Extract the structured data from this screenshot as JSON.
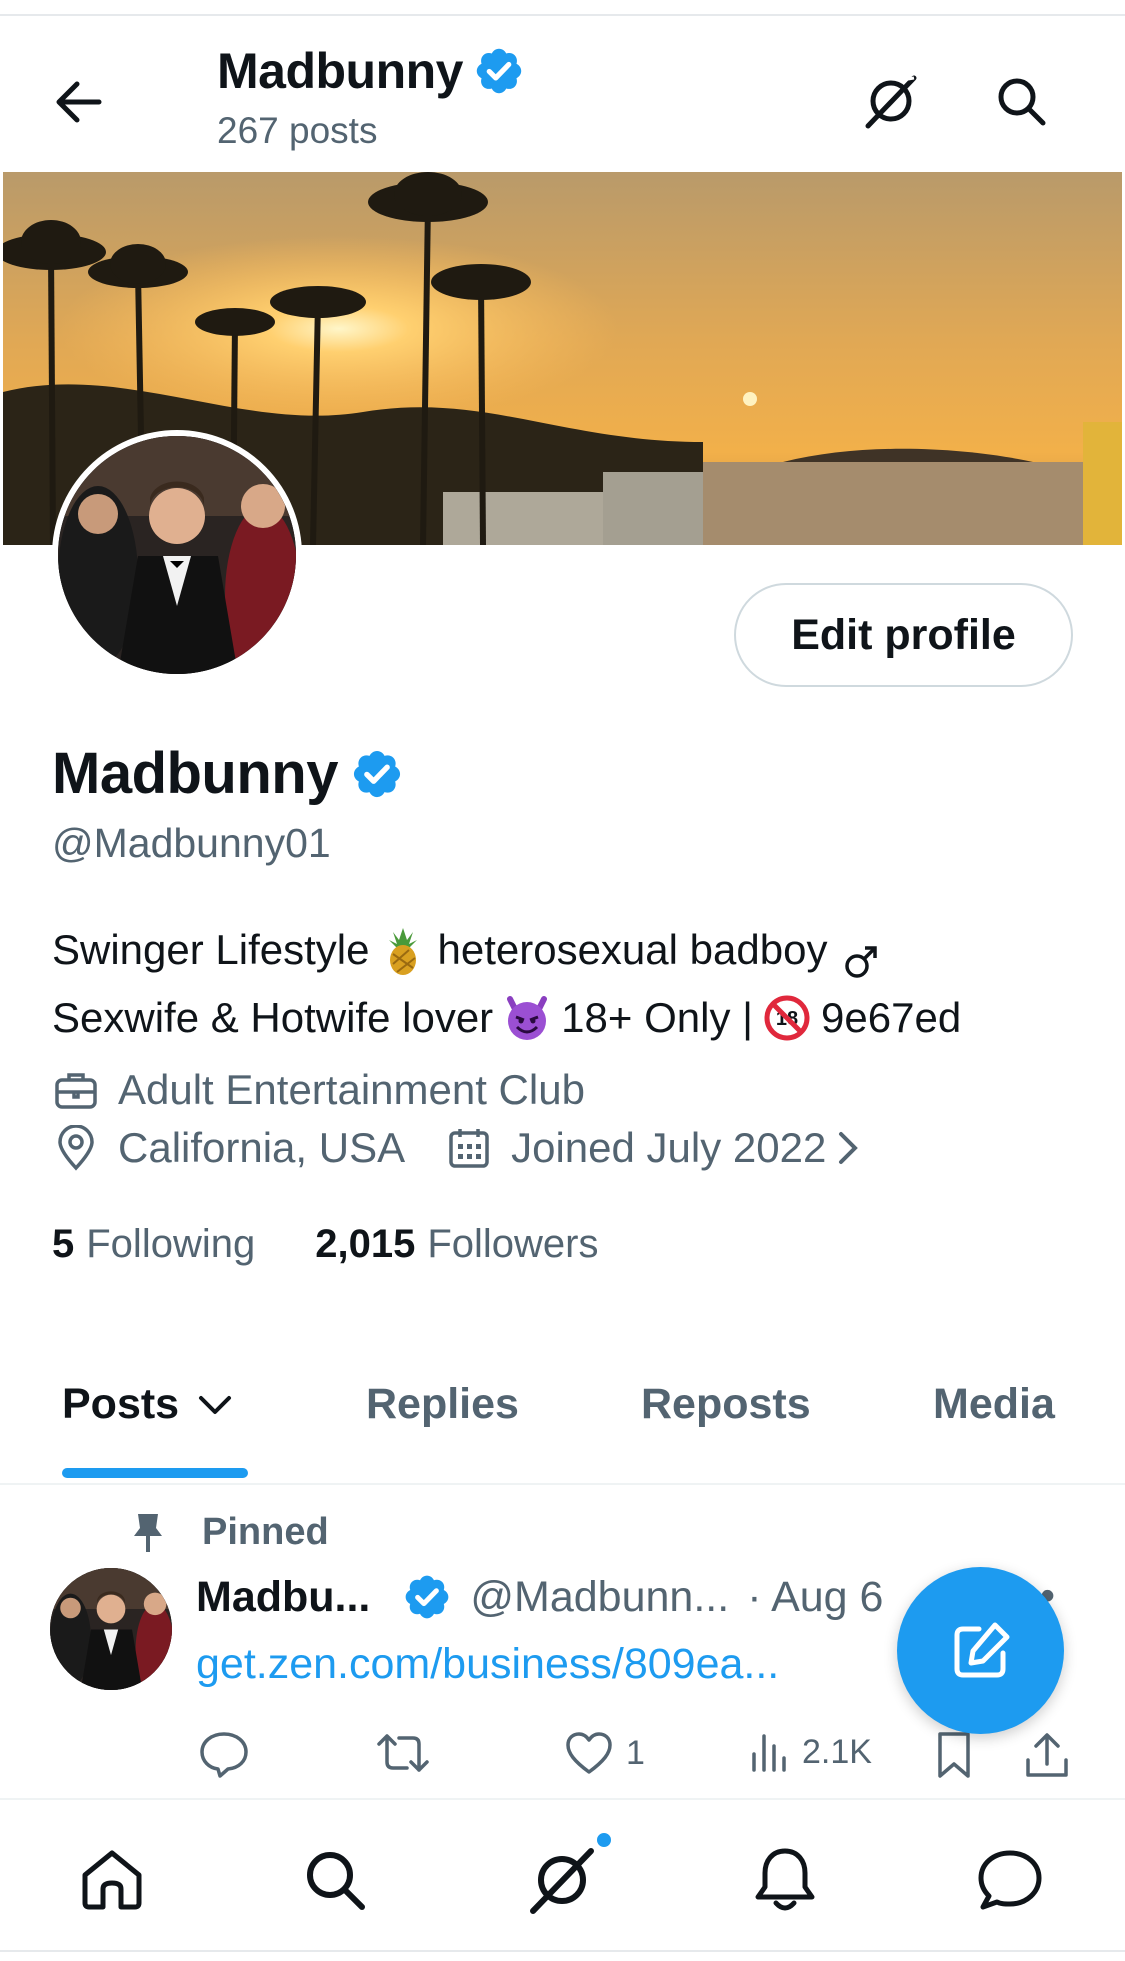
{
  "header": {
    "name": "Madbunny",
    "post_count": "267 posts"
  },
  "profile": {
    "display_name": "Madbunny",
    "handle": "@Madbunny01",
    "edit_button": "Edit profile",
    "bio": {
      "line1_a": "Swinger Lifestyle",
      "line1_b": "heterosexual badboy",
      "line2_a": "Sexwife & Hotwife lover",
      "line2_b": "18+ Only |",
      "line2_c": "9e67ed"
    },
    "category": "Adult Entertainment Club",
    "location": "California, USA",
    "joined": "Joined July 2022",
    "following_count": "5",
    "following_label": "Following",
    "followers_count": "2,015",
    "followers_label": "Followers"
  },
  "tabs": [
    {
      "label": "Posts"
    },
    {
      "label": "Replies"
    },
    {
      "label": "Reposts"
    },
    {
      "label": "Media"
    }
  ],
  "pinned_post": {
    "pinned_label": "Pinned",
    "author_name": "Madbu...",
    "author_handle": "@Madbunn...",
    "date": "· Aug 6",
    "link_text": "get.zen.com/business/809ea...",
    "likes": "1",
    "views": "2.1K"
  },
  "icons": {
    "back": "back-arrow-icon",
    "grok": "grok-icon",
    "search": "search-icon",
    "verified": "verified-badge-icon",
    "pineapple": "pineapple-emoji",
    "male": "male-sign-emoji",
    "devil": "smiling-devil-emoji",
    "no_under18": "no-one-under-eighteen-emoji",
    "briefcase": "briefcase-icon",
    "location": "location-pin-icon",
    "calendar": "calendar-icon"
  },
  "colors": {
    "accent": "#1d9bf0",
    "text": "#0f1419",
    "secondary": "#536471"
  }
}
